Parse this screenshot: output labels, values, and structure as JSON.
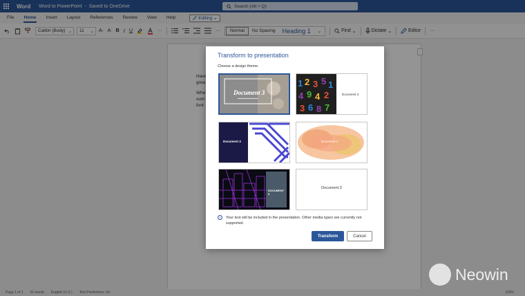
{
  "titlebar": {
    "app_name": "Word",
    "doc_name": "Word to PowerPoint",
    "separator": "-",
    "save_status": "Saved to OneDrive",
    "search_placeholder": "Search (Alt + Q)"
  },
  "tabs": [
    {
      "label": "File"
    },
    {
      "label": "Home"
    },
    {
      "label": "Insert"
    },
    {
      "label": "Layout"
    },
    {
      "label": "References"
    },
    {
      "label": "Review"
    },
    {
      "label": "View"
    },
    {
      "label": "Help"
    }
  ],
  "editing_label": "Editing",
  "ribbon": {
    "font_name": "Calibri (Body)",
    "font_size": "11",
    "bold": "B",
    "italic": "I",
    "underline": "U",
    "styles": [
      "Normal",
      "No Spacing",
      "Heading 1"
    ],
    "find_label": "Find",
    "dictate_label": "Dictate",
    "editor_label": "Editor",
    "more": "···"
  },
  "document": {
    "line1": "Have",
    "line2": "grea",
    "line3": "Whe",
    "line4": "sum",
    "line5": "font"
  },
  "dialog": {
    "title": "Transform to presentation",
    "subtitle": "Choose a design theme.",
    "themes": [
      {
        "title": "Document 3"
      },
      {
        "title": "Document 3"
      },
      {
        "title": "Document 3"
      },
      {
        "title": "Document 3"
      },
      {
        "title": "DOCUMENT 3"
      },
      {
        "title": "Document 3"
      }
    ],
    "info_text": "Your text will be included in the presentation. Other media types are currently not supported.",
    "transform_label": "Transform",
    "cancel_label": "Cancel"
  },
  "statusbar": {
    "page": "Page 1 of 1",
    "words": "52 words",
    "language": "English (U.S.)",
    "predictions": "Text Predictions: On",
    "zoom": "100%"
  },
  "watermark": "Neowin",
  "colors": {
    "brand": "#2b579a",
    "dialog_title": "#2b579a"
  }
}
